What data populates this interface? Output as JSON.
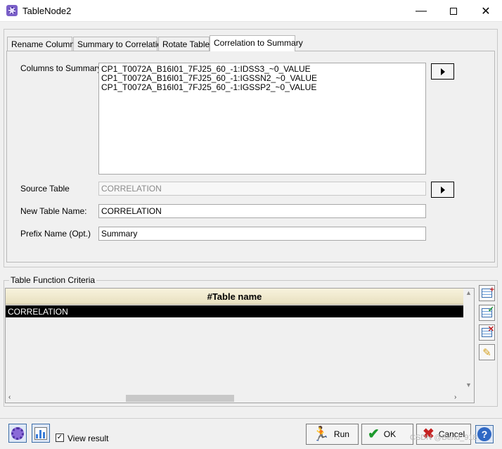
{
  "window": {
    "title": "TableNode2",
    "minimize_glyph": "—",
    "close_glyph": "✕"
  },
  "tabs": [
    {
      "label": "Rename Columns"
    },
    {
      "label": "Summary to Correlation"
    },
    {
      "label": "Rotate Table"
    },
    {
      "label": "Correlation to Summary"
    }
  ],
  "active_tab": "Correlation to Summary",
  "form": {
    "columns_label": "Columns to Summary",
    "columns": [
      "CP1_T0072A_B16I01_7FJ25_60_-1:IDSS3_~0_VALUE",
      "CP1_T0072A_B16I01_7FJ25_60_-1:IGSSN2_~0_VALUE",
      "CP1_T0072A_B16I01_7FJ25_60_-1:IGSSP2_~0_VALUE"
    ],
    "source_label": "Source Table",
    "source_value": "CORRELATION",
    "new_table_label": "New Table Name:",
    "new_table_value": "CORRELATION",
    "prefix_label": "Prefix Name (Opt.)",
    "prefix_value": "Summary"
  },
  "criteria": {
    "group_title": "Table Function Criteria",
    "column_header": "#Table name",
    "rows": [
      "CORRELATION"
    ],
    "side_buttons": [
      {
        "icon": "add-row-icon",
        "mark": "+"
      },
      {
        "icon": "check-row-icon",
        "mark": "✓"
      },
      {
        "icon": "delete-row-icon",
        "mark": "✕"
      },
      {
        "icon": "clear-icon",
        "mark": "✎"
      }
    ]
  },
  "footer": {
    "view_result_label": "View result",
    "view_result_checked": true,
    "check_glyph": "✓",
    "run_label": "Run",
    "ok_label": "OK",
    "cancel_label": "Cancel",
    "help_glyph": "?",
    "watermark": "CSDN @Bend_918"
  },
  "colors": {
    "selection": "#000000",
    "header_gradient": "#f8f3dd",
    "run_icon": "#1e9a2e",
    "ok_icon": "#1e9a2e",
    "cancel_icon": "#c62020"
  }
}
